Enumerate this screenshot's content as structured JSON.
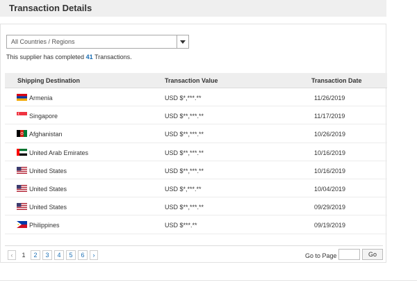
{
  "section": {
    "title": "Transaction Details"
  },
  "filter": {
    "selected": "All Countries / Regions"
  },
  "summary": {
    "prefix": "This supplier has completed",
    "count": "41",
    "suffix": "Transactions."
  },
  "table": {
    "headers": {
      "destination": "Shipping Destination",
      "value": "Transaction Value",
      "date": "Transaction Date"
    },
    "rows": [
      {
        "flag": "armenia-flag-icon",
        "destination": "Armenia",
        "value": "USD $*,***.**",
        "date": "11/26/2019"
      },
      {
        "flag": "singapore-flag-icon",
        "destination": "Singapore",
        "value": "USD $**,***.**",
        "date": "11/17/2019"
      },
      {
        "flag": "afghanistan-flag-icon",
        "destination": "Afghanistan",
        "value": "USD $**,***.**",
        "date": "10/26/2019"
      },
      {
        "flag": "uae-flag-icon",
        "destination": "United Arab Emirates",
        "value": "USD $**,***.**",
        "date": "10/16/2019"
      },
      {
        "flag": "us-flag-icon",
        "destination": "United States",
        "value": "USD $**,***.**",
        "date": "10/16/2019"
      },
      {
        "flag": "us-flag-icon",
        "destination": "United States",
        "value": "USD $*,***.**",
        "date": "10/04/2019"
      },
      {
        "flag": "us-flag-icon",
        "destination": "United States",
        "value": "USD $**,***.**",
        "date": "09/29/2019"
      },
      {
        "flag": "philippines-flag-icon",
        "destination": "Philippines",
        "value": "USD $***.**",
        "date": "09/19/2019"
      }
    ]
  },
  "pagination": {
    "prev_icon": "‹",
    "pages": [
      "1",
      "2",
      "3",
      "4",
      "5",
      "6"
    ],
    "current": "1",
    "next_icon": "›",
    "goto_label": "Go to Page",
    "goto_value": "",
    "go_label": "Go"
  },
  "colors": {
    "accent": "#1b6fb5",
    "header_bg": "#eeeeee",
    "title_bg": "#efefef"
  }
}
